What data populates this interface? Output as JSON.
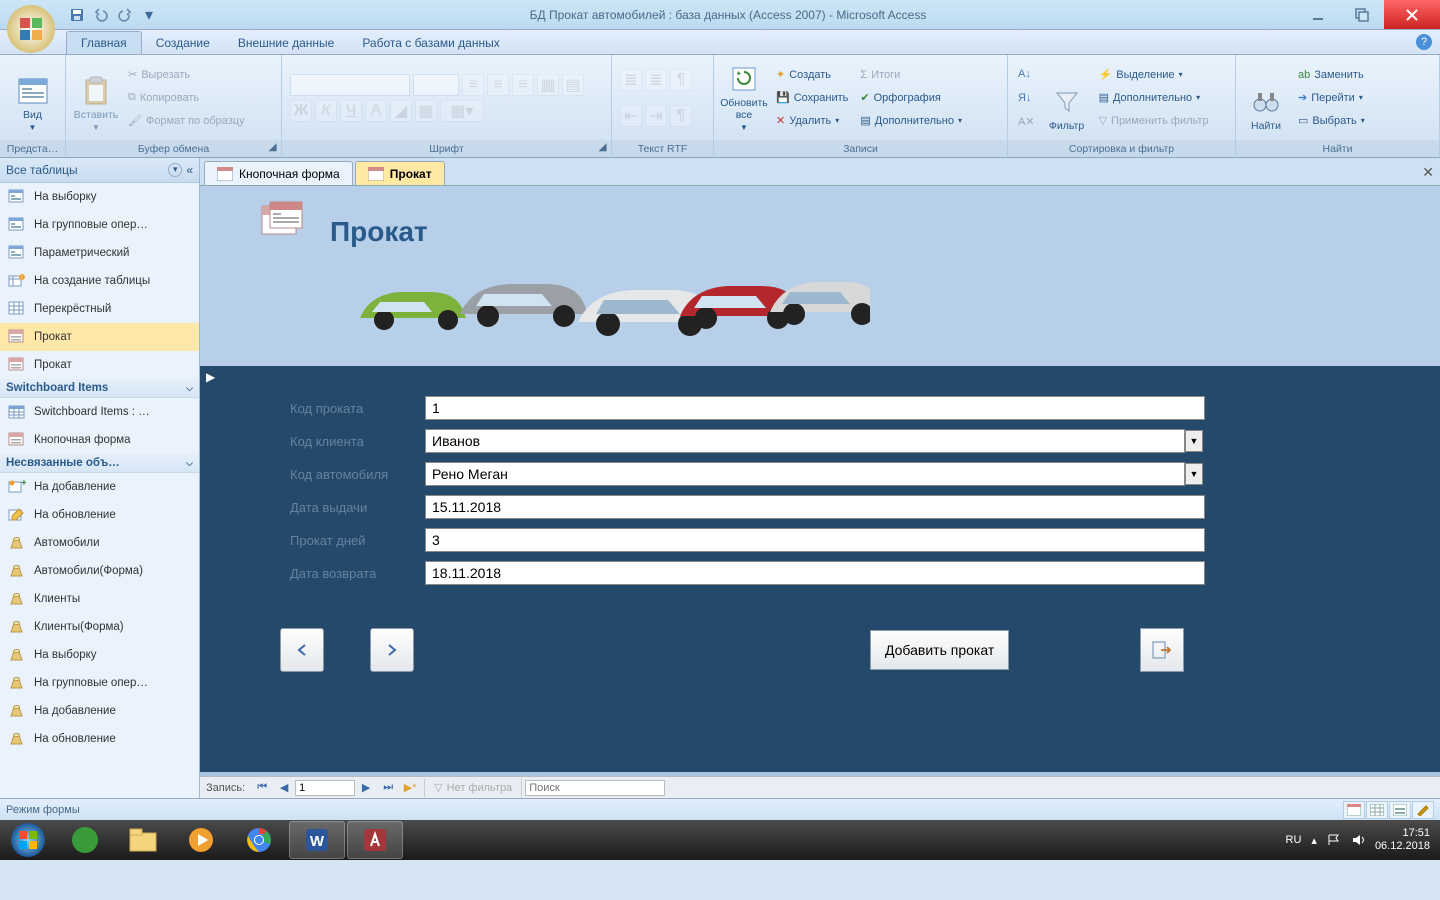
{
  "title": "БД Прокат автомобилей : база данных (Access 2007) - Microsoft Access",
  "ribbon_tabs": [
    "Главная",
    "Создание",
    "Внешние данные",
    "Работа с базами данных"
  ],
  "ribbon": {
    "view": {
      "big": "Вид",
      "group": "Предста…"
    },
    "clipboard": {
      "big": "Вставить",
      "cut": "Вырезать",
      "copy": "Копировать",
      "painter": "Формат по образцу",
      "group": "Буфер обмена"
    },
    "font": {
      "group": "Шрифт"
    },
    "richtext": {
      "group": "Текст RTF"
    },
    "records": {
      "refresh": "Обновить\nвсе",
      "new": "Создать",
      "save": "Сохранить",
      "delete": "Удалить",
      "totals": "Итоги",
      "spell": "Орфография",
      "more": "Дополнительно",
      "group": "Записи"
    },
    "sortfilter": {
      "filter": "Фильтр",
      "selection": "Выделение",
      "advanced": "Дополнительно",
      "toggle": "Применить фильтр",
      "group": "Сортировка и фильтр"
    },
    "find": {
      "find": "Найти",
      "replace": "Заменить",
      "goto": "Перейти",
      "select": "Выбрать",
      "group": "Найти"
    }
  },
  "nav_header": "Все таблицы",
  "nav_section1_items": [
    "На выборку",
    "На групповые опер…",
    "Параметрический",
    "На создание таблицы",
    "Перекрёстный",
    "Прокат",
    "Прокат"
  ],
  "nav_section2": "Switchboard Items",
  "nav_section2_items": [
    "Switchboard Items : …",
    "Кнопочная форма"
  ],
  "nav_section3": "Несвязанные объ…",
  "nav_section3_items": [
    "На добавление",
    "На обновление",
    "Автомобили",
    "Автомобили(Форма)",
    "Клиенты",
    "Клиенты(Форма)",
    "На выборку",
    "На групповые опер…",
    "На добавление",
    "На обновление"
  ],
  "doc_tabs": [
    "Кнопочная форма",
    "Прокат"
  ],
  "form_title": "Прокат",
  "form_labels": {
    "f1": "Код проката",
    "f2": "Код клиента",
    "f3": "Код автомобиля",
    "f4": "Дата выдачи",
    "f5": "Прокат дней",
    "f6": "Дата возврата"
  },
  "form_values": {
    "f1": "1",
    "f2": "Иванов",
    "f3": "Рено Меган",
    "f4": "15.11.2018",
    "f5": "3",
    "f6": "18.11.2018"
  },
  "add_btn": "Добавить прокат",
  "recnav": {
    "label": "Запись:",
    "val": "1",
    "filter": "Нет фильтра",
    "search_ph": "Поиск"
  },
  "status": "Режим формы",
  "tray": {
    "lang": "RU",
    "time": "17:51",
    "date": "06.12.2018"
  }
}
